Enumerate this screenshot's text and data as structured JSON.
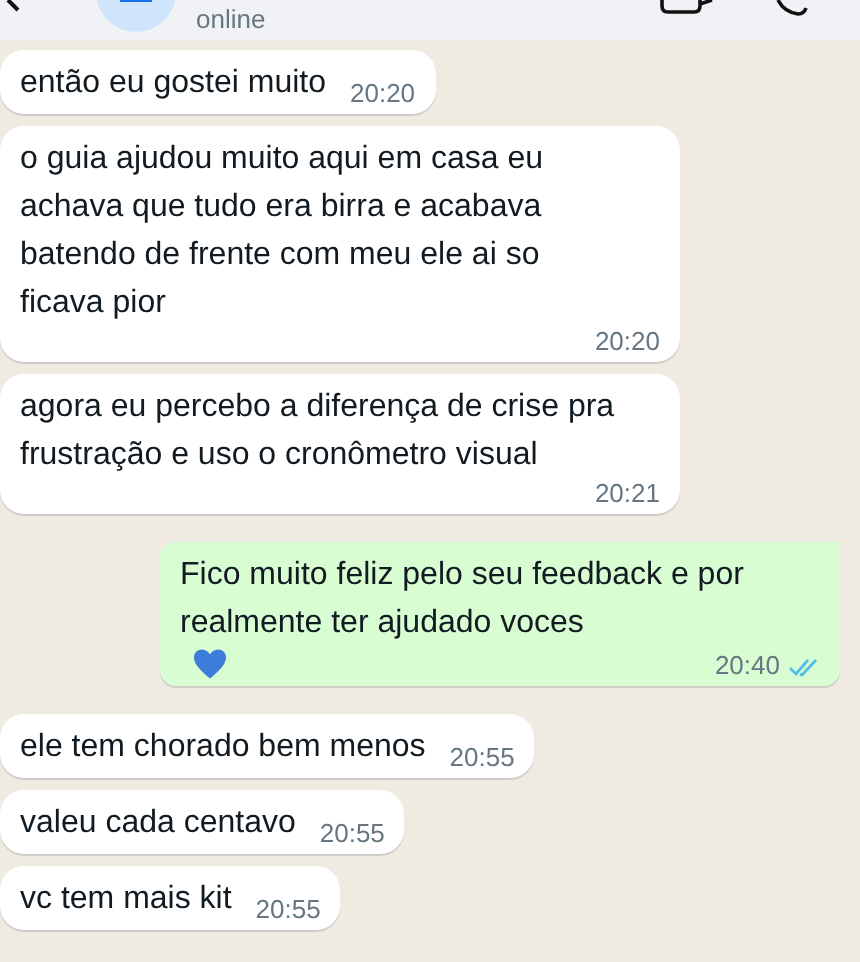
{
  "header": {
    "status": "online"
  },
  "messages": [
    {
      "kind": "incoming",
      "text": "então eu gostei muito",
      "time": "20:20"
    },
    {
      "kind": "incoming",
      "text": "o guia ajudou muito aqui em casa eu achava que tudo era birra e acabava batendo de frente com meu ele ai so ficava pior",
      "time": "20:20"
    },
    {
      "kind": "incoming",
      "text": "agora eu percebo a diferença de crise pra frustração e uso o cronômetro visual",
      "time": "20:21"
    },
    {
      "kind": "outgoing",
      "text": "Fico muito feliz pelo seu feedback e por realmente ter ajudado voces",
      "heart": true,
      "time": "20:40",
      "read": true
    },
    {
      "kind": "incoming",
      "text": "ele tem chorado bem menos",
      "time": "20:55"
    },
    {
      "kind": "incoming",
      "text": "valeu cada centavo",
      "time": "20:55"
    },
    {
      "kind": "incoming",
      "text": "vc tem mais kit",
      "time": "20:55"
    }
  ]
}
